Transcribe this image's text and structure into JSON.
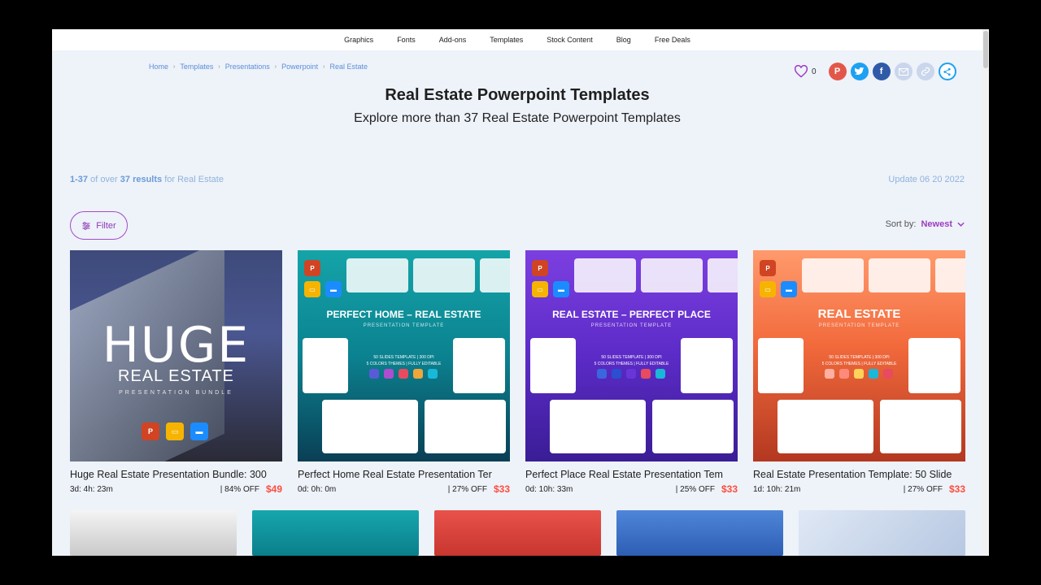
{
  "nav": {
    "items": [
      "Graphics",
      "Fonts",
      "Add-ons",
      "Templates",
      "Stock Content",
      "Blog",
      "Free Deals"
    ]
  },
  "breadcrumb": [
    "Home",
    "Templates",
    "Presentations",
    "Powerpoint",
    "Real Estate"
  ],
  "favorites": {
    "count": "0"
  },
  "social_icons": [
    "pinterest-icon",
    "twitter-icon",
    "facebook-icon",
    "mail-icon",
    "link-icon",
    "share-icon"
  ],
  "page": {
    "title": "Real Estate Powerpoint Templates",
    "subtitle": "Explore more than 37 Real Estate Powerpoint Templates"
  },
  "results": {
    "range": "1-37",
    "of_over": " of over ",
    "total": "37 results",
    "for": " for Real Estate",
    "update": "Update 06 20 2022"
  },
  "filter": {
    "label": "Filter"
  },
  "sort": {
    "label": "Sort by:",
    "value": "Newest"
  },
  "products": [
    {
      "title": "Huge Real Estate Presentation Bundle: 300",
      "timer": "3d: 4h: 23m",
      "off": "| 84% OFF",
      "price": "$49",
      "thumb": {
        "word": "HUGE",
        "sub": "REAL ESTATE",
        "sub2": "PRESENTATION BUNDLE"
      }
    },
    {
      "title": "Perfect Home Real Estate Presentation Ter",
      "timer": "0d: 0h: 0m",
      "off": "| 27% OFF",
      "price": "$33",
      "thumb": {
        "head": "PERFECT HOME – REAL ESTATE",
        "sub": "PRESENTATION TEMPLATE",
        "feat": "50 SLIDES TEMPLATE | 300 DPI",
        "feat2": "5 COLORS THEMES | FULLY EDITABLE"
      }
    },
    {
      "title": "Perfect Place Real Estate Presentation Tem",
      "timer": "0d: 10h: 33m",
      "off": "| 25% OFF",
      "price": "$33",
      "thumb": {
        "head": "REAL ESTATE – PERFECT PLACE",
        "sub": "PRESENTATION TEMPLATE",
        "feat": "50 SLIDES TEMPLATE | 300 DPI",
        "feat2": "5 COLORS THEMES | FULLY EDITABLE"
      }
    },
    {
      "title": "Real Estate Presentation Template: 50 Slide",
      "timer": "1d: 10h: 21m",
      "off": "| 27% OFF",
      "price": "$33",
      "thumb": {
        "head": "REAL ESTATE",
        "sub": "PRESENTATION TEMPLATE",
        "feat": "50 SLIDES TEMPLATE | 300 DPI",
        "feat2": "5 COLORS THEMES | FULLY EDITABLE"
      }
    }
  ],
  "colors": {
    "accent": "#9b3ec1",
    "price": "#ff4d3d",
    "link": "#5b8fd8",
    "teal_dots": [
      "#5a5ad8",
      "#b04ccf",
      "#e84a5f",
      "#f0a63a",
      "#19b8d8"
    ],
    "purple_dots": [
      "#3a66e0",
      "#2a4fd0",
      "#6a35d8",
      "#e84a5f",
      "#19b8d8"
    ],
    "orange_dots": [
      "#ffb0a0",
      "#ff8a7a",
      "#ffd25a",
      "#19b8d8",
      "#e84a5f"
    ]
  }
}
